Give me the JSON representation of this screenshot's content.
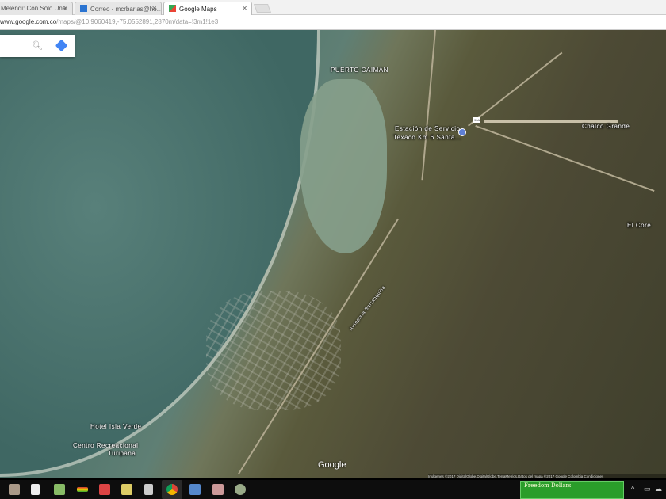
{
  "browser": {
    "tabs": [
      {
        "label": "Melendi: Con Sólo Una...",
        "active": false
      },
      {
        "label": "Correo - mcrbarias@ho...",
        "active": false
      },
      {
        "label": "Google Maps",
        "active": true
      }
    ],
    "url_host": "www.google.com.co",
    "url_path": "/maps/@10.9060419,-75.0552891,2870m/data=!3m1!1e3"
  },
  "map": {
    "labels": {
      "puerto": "PUERTO CAIMAN",
      "station_1": "Estación de Servicio",
      "station_2": "Texaco Km 6 Santa...",
      "chalco": "Chalco Grande",
      "corec": "El Core",
      "road": "Autopista Barranquilla",
      "hotel": "Hotel Isla Verde",
      "centro_1": "Centro Recreacional",
      "centro_2": "Turipana",
      "road_shield": "90A"
    },
    "logo": "Google",
    "attribution": "Imágenes ©2017 DigitalGlobe,DigitalGlobe,TerraMetrics,Datos del mapa ©2017 Google   Colombia   Condiciones"
  },
  "taskbar": {
    "widget_title": "Freedom Dollars"
  },
  "colors": {
    "accent": "#4285f4",
    "widget": "#2a9d2a"
  }
}
